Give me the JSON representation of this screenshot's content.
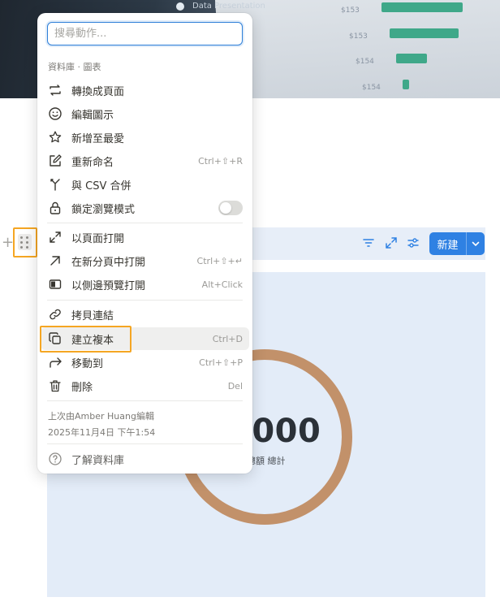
{
  "cover": {
    "rows": [
      {
        "label": "$153",
        "fill": 0.85
      },
      {
        "label": "$153",
        "fill": 0.72
      },
      {
        "label": "$154",
        "fill": 0.33
      },
      {
        "label": "$154",
        "fill": 0.06
      }
    ],
    "caption": "Data Presentation"
  },
  "toolbar": {
    "new_label": "新建"
  },
  "chart": {
    "value": "0000",
    "caption": "總額 總計",
    "ring_color": "#c2916a",
    "panel_color": "#e3ecf8"
  },
  "menu": {
    "search_placeholder": "搜尋動作...",
    "section_label": "資料庫 · 圖表",
    "items": [
      {
        "label": "轉換成頁面",
        "icon": "convert-icon"
      },
      {
        "label": "編輯圖示",
        "icon": "smiley-icon"
      },
      {
        "label": "新增至最愛",
        "icon": "star-icon"
      },
      {
        "label": "重新命名",
        "icon": "pencil-square-icon",
        "shortcut": "Ctrl+⇧+R"
      },
      {
        "label": "與 CSV 合併",
        "icon": "merge-icon"
      },
      {
        "label": "鎖定瀏覽模式",
        "icon": "lock-icon",
        "toggle": false
      },
      {
        "label": "以頁面打開",
        "icon": "expand-icon"
      },
      {
        "label": "在新分頁中打開",
        "icon": "arrow-up-right-icon",
        "shortcut": "Ctrl+⇧+↵"
      },
      {
        "label": "以側邊預覽打開",
        "icon": "side-peek-icon",
        "shortcut": "Alt+Click"
      },
      {
        "label": "拷貝連結",
        "icon": "link-icon"
      },
      {
        "label": "建立複本",
        "icon": "duplicate-icon",
        "shortcut": "Ctrl+D"
      },
      {
        "label": "移動到",
        "icon": "move-to-icon",
        "shortcut": "Ctrl+⇧+P"
      },
      {
        "label": "刪除",
        "icon": "trash-icon",
        "shortcut": "Del"
      }
    ],
    "last_edited_by": "上次由Amber Huang編輯",
    "last_edited_time": "2025年11月4日 下午1:54",
    "help_label": "了解資料庫"
  }
}
